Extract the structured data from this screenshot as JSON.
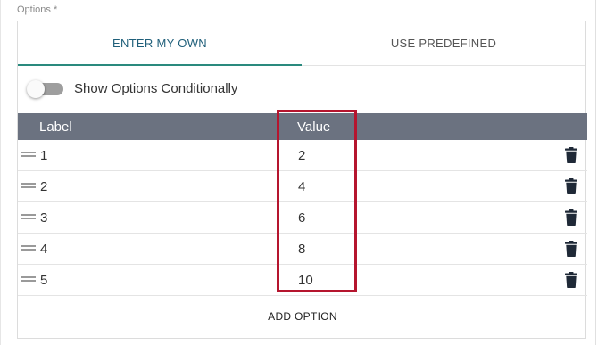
{
  "field": {
    "label": "Options *"
  },
  "tabs": [
    {
      "label": "ENTER MY OWN",
      "active": true
    },
    {
      "label": "USE PREDEFINED",
      "active": false
    }
  ],
  "toggle": {
    "label": "Show Options Conditionally",
    "on": false
  },
  "table": {
    "headers": {
      "label": "Label",
      "value": "Value"
    },
    "rows": [
      {
        "label": "1",
        "value": "2"
      },
      {
        "label": "2",
        "value": "4"
      },
      {
        "label": "3",
        "value": "6"
      },
      {
        "label": "4",
        "value": "8"
      },
      {
        "label": "5",
        "value": "10"
      }
    ]
  },
  "add_option_label": "ADD OPTION",
  "colors": {
    "header_bg": "#6b7280",
    "active_tab_text": "#1f5f7a",
    "active_tab_underline": "#2a8a7e",
    "highlight_border": "#b5152e",
    "trash_icon": "#1f2937"
  },
  "icons": {
    "drag": "drag-handle-icon",
    "delete": "trash-icon"
  }
}
